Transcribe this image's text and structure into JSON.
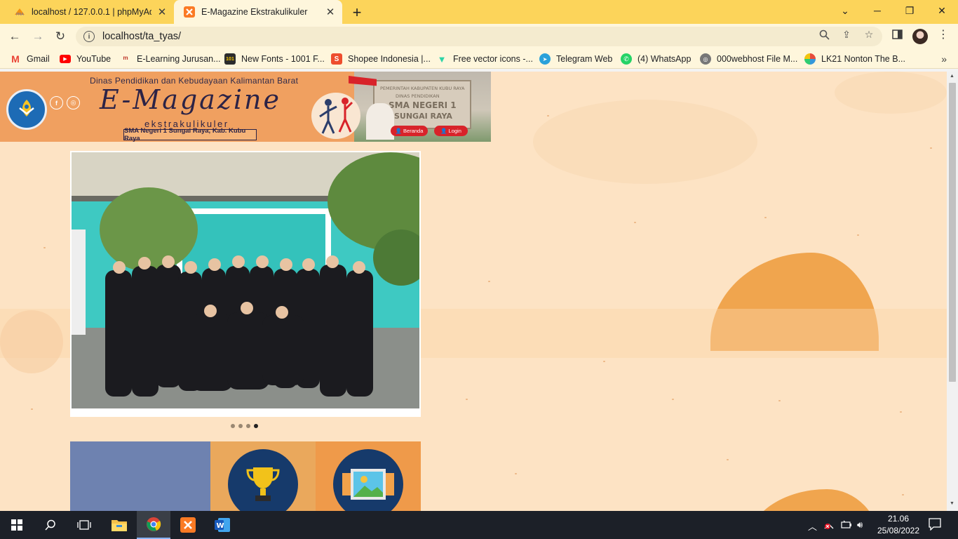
{
  "browser": {
    "tabs": [
      {
        "title": "localhost / 127.0.0.1 | phpMyAdm",
        "favicon": "phpmyadmin-icon",
        "active": false
      },
      {
        "title": "E-Magazine Ekstrakulikuler",
        "favicon": "xampp-icon",
        "active": true
      }
    ],
    "url": "localhost/ta_tyas/",
    "bookmarks": [
      {
        "label": "Gmail",
        "icon": "gmail-icon",
        "color": "#ea4335"
      },
      {
        "label": "YouTube",
        "icon": "youtube-icon",
        "color": "#ff0000"
      },
      {
        "label": "E-Learning Jurusan...",
        "icon": "elearning-icon",
        "color": "#c0392b"
      },
      {
        "label": "New Fonts - 1001 F...",
        "icon": "fonts-icon",
        "color": "#2c2c2c"
      },
      {
        "label": "Shopee Indonesia |...",
        "icon": "shopee-icon",
        "color": "#ee4d2d"
      },
      {
        "label": "Free vector icons -...",
        "icon": "flaticon-icon",
        "color": "#2dd4a6"
      },
      {
        "label": "Telegram Web",
        "icon": "telegram-icon",
        "color": "#2aa1da"
      },
      {
        "label": "(4) WhatsApp",
        "icon": "whatsapp-icon",
        "color": "#25d366"
      },
      {
        "label": "000webhost File M...",
        "icon": "webhost-icon",
        "color": "#777777"
      },
      {
        "label": "LK21 Nonton The B...",
        "icon": "lk21-icon",
        "color": "#e74c3c"
      }
    ]
  },
  "page": {
    "header": {
      "agency": "Dinas Pendidikan dan Kebudayaan Kalimantan Barat",
      "title": "E-Magazine",
      "subtitle": "ekstrakulikuler",
      "school": "SMA Negeri 1 Sungai Raya, Kab. Kubu Raya",
      "sign_lines": [
        "PEMERINTAH KABUPATEN KUBU RAYA",
        "DINAS PENDIDIKAN",
        "SMA NEGERI 1",
        "SUNGAI RAYA"
      ],
      "buttons": {
        "home": "Beranda",
        "login": "Login"
      },
      "social": [
        "facebook-icon",
        "instagram-icon"
      ]
    },
    "slider": {
      "slides": 4,
      "active_index": 3
    },
    "tiles": [
      {
        "color": "#6e82b0",
        "icon": ""
      },
      {
        "color": "#eaa85c",
        "icon": "trophy-icon"
      },
      {
        "color": "#ef9a4a",
        "icon": "gallery-icon"
      }
    ]
  },
  "taskbar": {
    "time": "21.06",
    "date": "25/08/2022",
    "apps": [
      "file-explorer-icon",
      "chrome-icon",
      "xampp-icon",
      "word-icon"
    ]
  }
}
